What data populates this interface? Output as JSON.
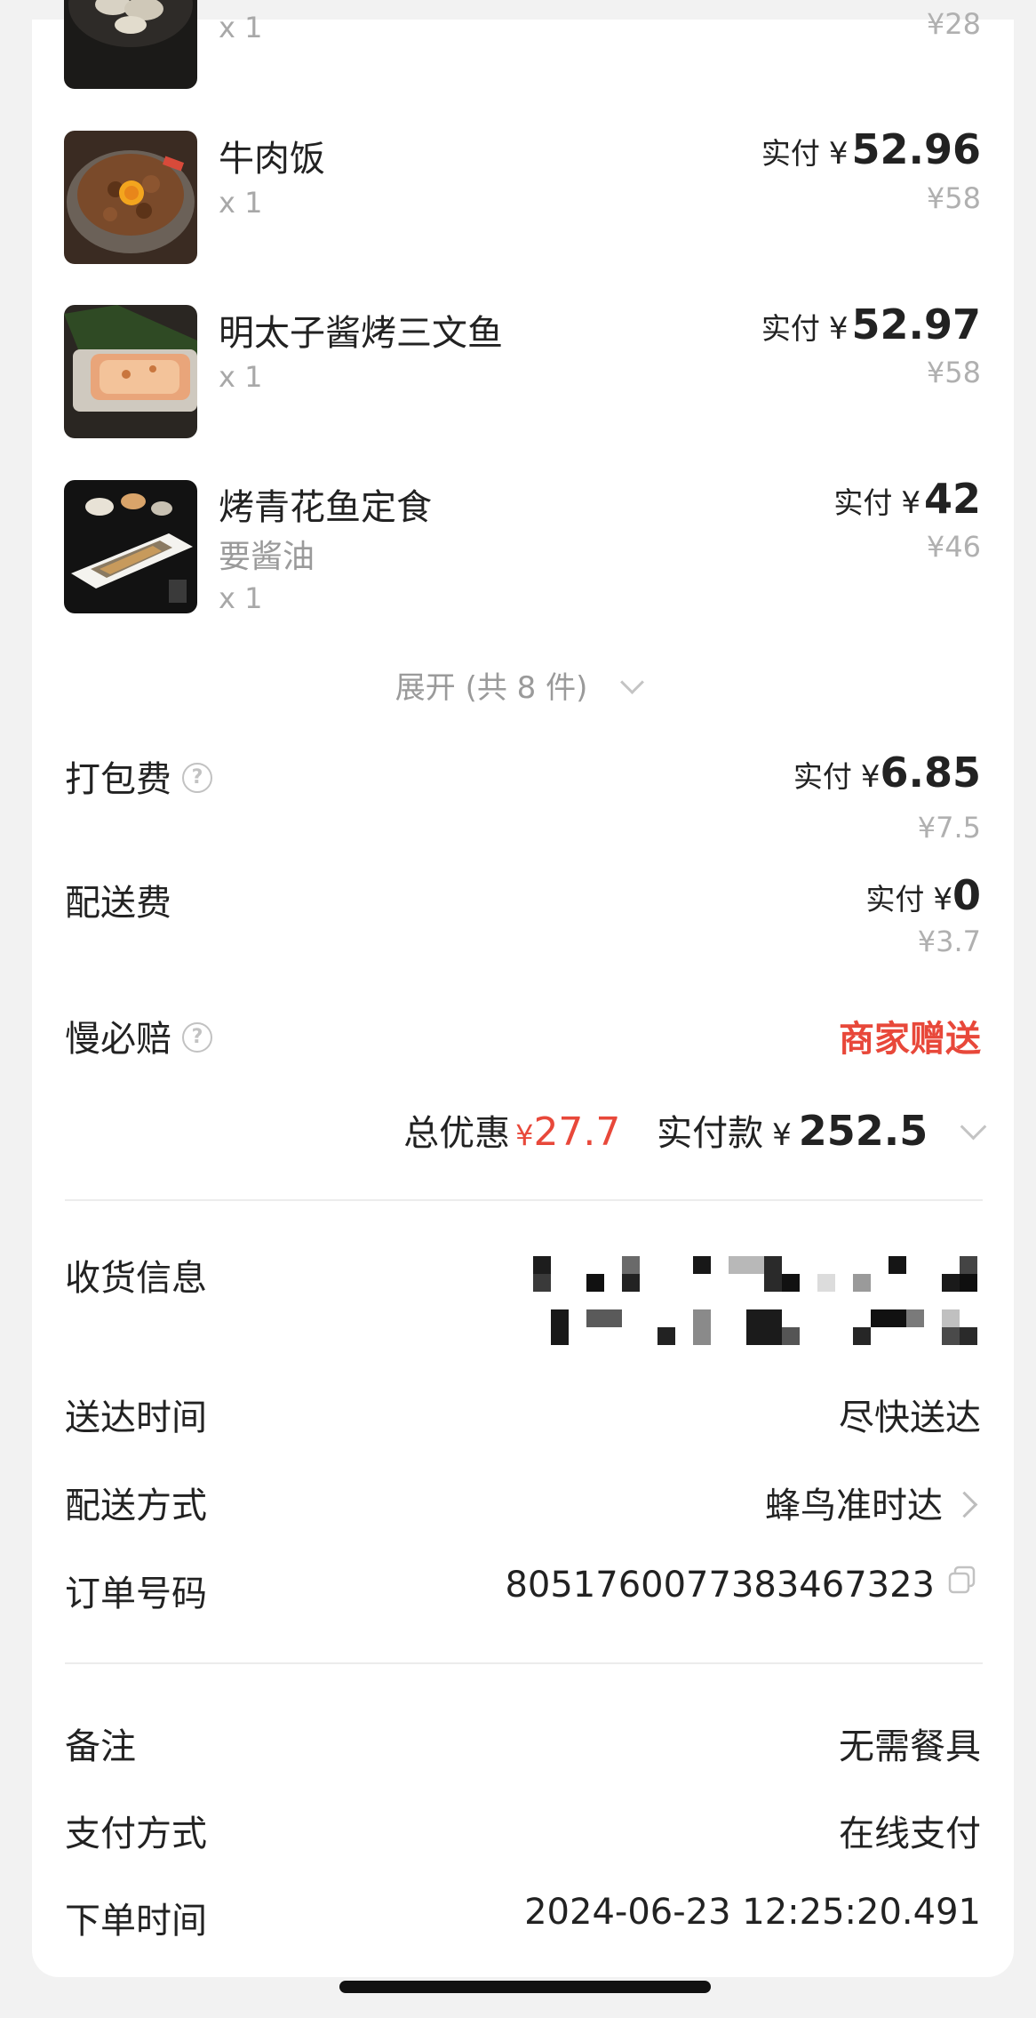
{
  "items": [
    {
      "name": "",
      "qty": "x 1",
      "paid_label": "",
      "paid_yen": "",
      "paid_amount": "",
      "original": "¥28"
    },
    {
      "name": "牛肉饭",
      "qty": "x 1",
      "paid_label": "实付",
      "paid_yen": "¥",
      "paid_amount": "52.96",
      "original": "¥58"
    },
    {
      "name": "明太子酱烤三文鱼",
      "qty": "x 1",
      "paid_label": "实付",
      "paid_yen": "¥",
      "paid_amount": "52.97",
      "original": "¥58"
    },
    {
      "name": "烤青花鱼定食",
      "note": "要酱油",
      "qty": "x 1",
      "paid_label": "实付",
      "paid_yen": "¥",
      "paid_amount": "42",
      "original": "¥46"
    }
  ],
  "expand": {
    "label": "展开 (共 8 件)"
  },
  "fees": {
    "packing": {
      "label": "打包费",
      "paid_label": "实付",
      "paid_yen": "¥",
      "paid_amount": "6.85",
      "original": "¥7.5"
    },
    "delivery": {
      "label": "配送费",
      "paid_label": "实付",
      "paid_yen": "¥",
      "paid_amount": "0",
      "original": "¥3.7"
    },
    "late_comp": {
      "label": "慢必赔",
      "value": "商家赠送"
    }
  },
  "totals": {
    "discount_label": "总优惠",
    "discount_yen": "¥",
    "discount_value": "27.7",
    "paid_label": "实付款",
    "paid_yen": "¥",
    "paid_value": "252.5"
  },
  "info": {
    "receiver": {
      "label": "收货信息"
    },
    "delivery_time": {
      "label": "送达时间",
      "value": "尽快送达"
    },
    "delivery_method": {
      "label": "配送方式",
      "value": "蜂鸟准时达"
    },
    "order_number": {
      "label": "订单号码",
      "value": "8051760077383467323"
    },
    "remark": {
      "label": "备注",
      "value": "无需餐具"
    },
    "payment": {
      "label": "支付方式",
      "value": "在线支付"
    },
    "order_time": {
      "label": "下单时间",
      "value": "2024-06-23 12:25:20.491"
    }
  },
  "colors": {
    "accent_red": "#e8483a",
    "muted_gray": "#a8a8a8",
    "text": "#1f1f1f"
  },
  "icons": [
    "question-icon",
    "chevron-down-icon",
    "chevron-right-icon",
    "copy-icon"
  ]
}
